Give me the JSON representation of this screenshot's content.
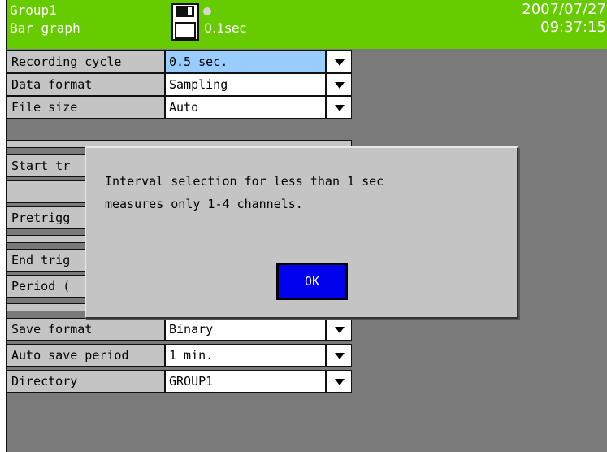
{
  "header": {
    "group": "Group1",
    "mode": "Bar graph",
    "interval": "0.1sec",
    "date": "2007/07/27",
    "time": "09:37:15",
    "storage_icon": "floppy-disk-icon",
    "bg_color": "#66cc00"
  },
  "settings": {
    "recording_cycle": {
      "label": "Recording cycle",
      "value": "0.5 sec."
    },
    "data_format": {
      "label": "Data format",
      "value": "Sampling"
    },
    "file_size": {
      "label": "File size",
      "value": "Auto"
    },
    "start_trigger": {
      "label": "Start tr"
    },
    "pretrigger": {
      "label": "Pretrigg"
    },
    "end_trigger": {
      "label": "End trig"
    },
    "period": {
      "label": "Period ("
    },
    "save_format": {
      "label": "Save format",
      "value": "Binary"
    },
    "auto_save_period": {
      "label": "Auto save period",
      "value": "1 min."
    },
    "directory": {
      "label": "Directory",
      "value": "GROUP1"
    }
  },
  "dialog": {
    "line1": "Interval selection for less than 1 sec",
    "line2": "measures only 1-4 channels.",
    "ok_label": "OK"
  }
}
